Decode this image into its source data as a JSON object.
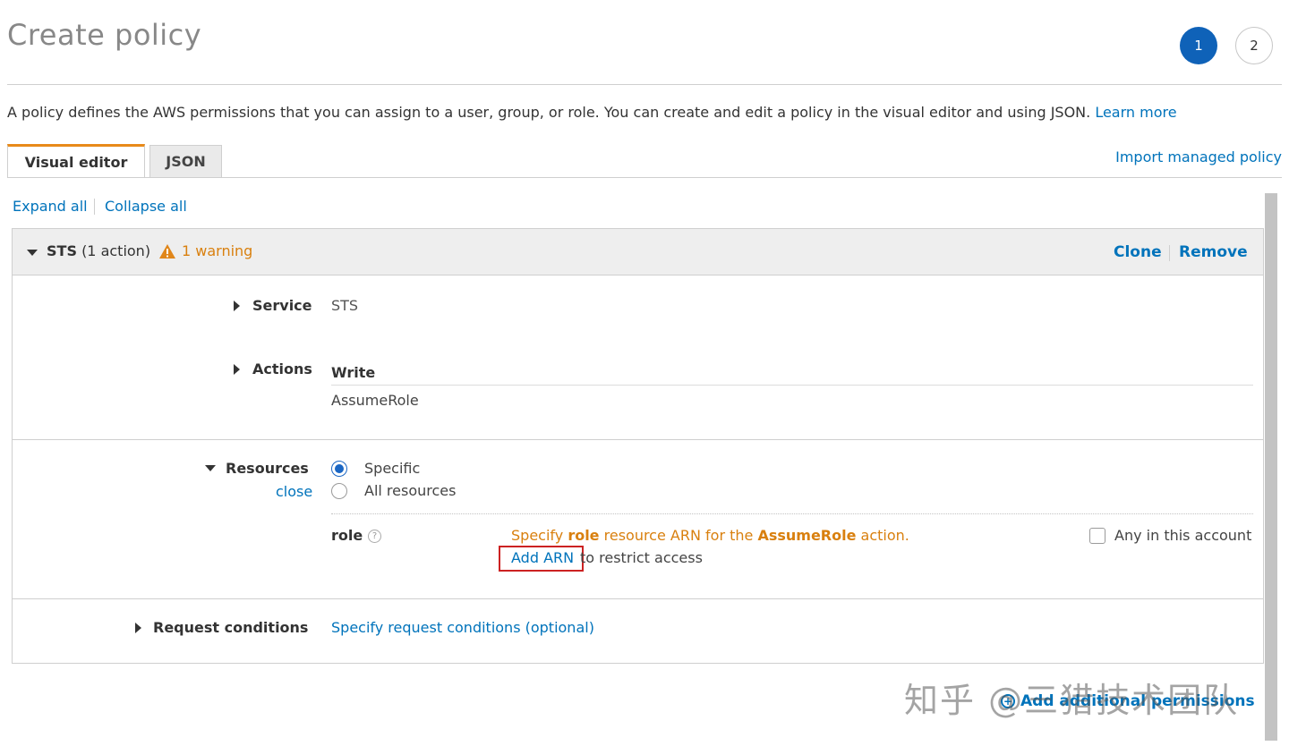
{
  "header": {
    "title": "Create policy",
    "steps": [
      "1",
      "2"
    ],
    "intro": "A policy defines the AWS permissions that you can assign to a user, group, or role. You can create and edit a policy in the visual editor and using JSON.",
    "learn_more": "Learn more"
  },
  "tabs": [
    {
      "label": "Visual editor",
      "active": true
    },
    {
      "label": "JSON",
      "active": false
    }
  ],
  "import_link": "Import managed policy",
  "toolbar": {
    "expand_all": "Expand all",
    "collapse_all": "Collapse all"
  },
  "statement": {
    "service_name": "STS",
    "action_count": "(1 action)",
    "warning": "1 warning",
    "clone": "Clone",
    "remove": "Remove",
    "service": {
      "label": "Service",
      "value": "STS"
    },
    "actions": {
      "label": "Actions",
      "group": "Write",
      "value": "AssumeRole"
    },
    "resources": {
      "label": "Resources",
      "close": "close",
      "options": [
        "Specific",
        "All resources"
      ],
      "selected": "Specific",
      "role": {
        "label": "role",
        "help": "?",
        "msg_specify": "Specify ",
        "msg_role": "role",
        "msg_mid": " resource ARN for the ",
        "msg_action": "AssumeRole",
        "msg_end": " action.",
        "add_arn": "Add ARN",
        "restrict": " to restrict access",
        "any_account": "Any in this account"
      }
    },
    "conditions": {
      "label": "Request conditions",
      "link": "Specify request conditions (optional)"
    }
  },
  "add_permissions": "Add additional permissions",
  "watermark": "知乎 @三猎技术团队",
  "colors": {
    "accent": "#0073bb",
    "warning": "#d9800f",
    "tab_active": "#e88a1a",
    "step_active": "#0f62b8",
    "highlight_box": "#cc2222"
  }
}
